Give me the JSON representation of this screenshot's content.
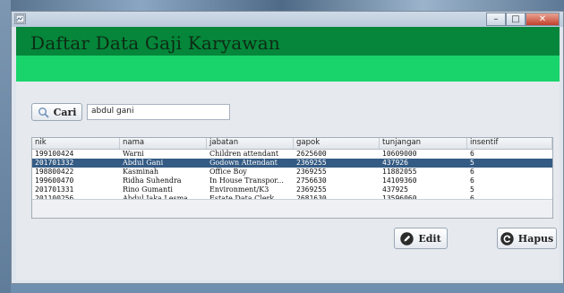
{
  "window": {
    "title": "",
    "app_icon": "window-app-icon",
    "controls": {
      "minimize": "–",
      "maximize": "□",
      "close": "✕"
    }
  },
  "header": {
    "title": "Daftar Data Gaji Karyawan"
  },
  "search": {
    "button_label": "Cari",
    "value": "abdul gani"
  },
  "table": {
    "columns": [
      "nik",
      "nama",
      "jabatan",
      "gapok",
      "tunjangan",
      "insentif"
    ],
    "rows": [
      [
        "199100424",
        "Warni",
        "Children attendant",
        "2625600",
        "10609000",
        "6"
      ],
      [
        "201701332",
        "Abdul Gani",
        "Godown Attendant",
        "2369255",
        "437926",
        "5"
      ],
      [
        "198800422",
        "Kasminah",
        "Office Boy",
        "2369255",
        "11882055",
        "6"
      ],
      [
        "199600470",
        "Ridha Suhendra",
        "In House Transpor...",
        "2756630",
        "14109360",
        "6"
      ],
      [
        "201701331",
        "Rino Gumanti",
        "Environment/K3",
        "2369255",
        "437925",
        "5"
      ],
      [
        "201100256",
        "Abdul Jaka Lesma...",
        "Estate Data Clerk",
        "2681630",
        "13596060",
        "6"
      ]
    ],
    "selected_index": 1
  },
  "actions": {
    "edit_label": "Edit",
    "delete_label": "Hapus"
  },
  "colors": {
    "header_dark": "#05863a",
    "header_light": "#18d46a",
    "selection": "#345b84"
  },
  "icons": {
    "search": "magnifier-icon",
    "edit": "pencil-icon",
    "delete": "refresh-icon"
  }
}
